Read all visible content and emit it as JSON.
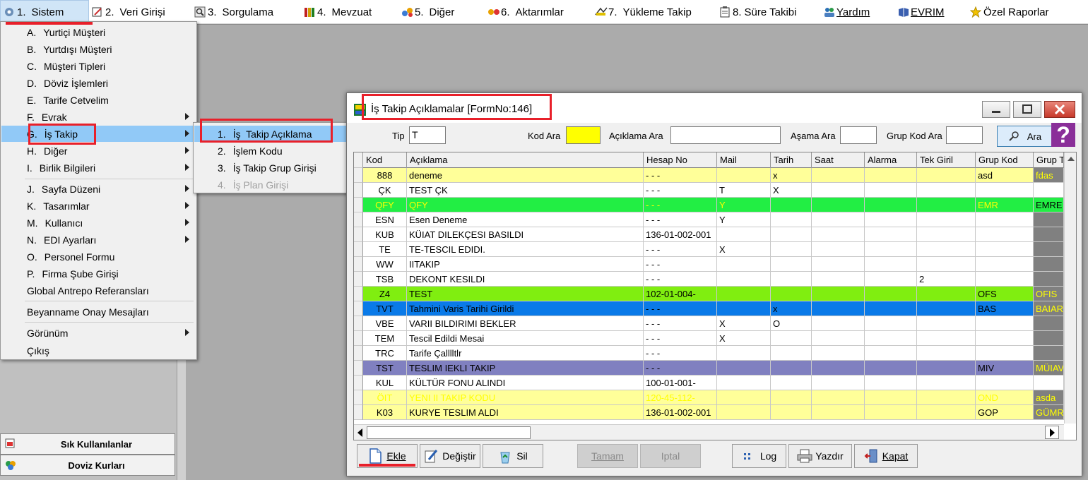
{
  "menubar": {
    "items": [
      {
        "num": "1.",
        "label": "Sistem"
      },
      {
        "num": "2.",
        "label": "Veri Girişi"
      },
      {
        "num": "3.",
        "label": "Sorgulama"
      },
      {
        "num": "4.",
        "label": "Mevzuat"
      },
      {
        "num": "5.",
        "label": "Diğer"
      },
      {
        "num": "6.",
        "label": "Aktarımlar"
      },
      {
        "num": "7.",
        "label": "Yükleme Takip"
      },
      {
        "num": "8.",
        "label": "Süre Takibi"
      },
      {
        "num": "",
        "label": "Yardım"
      },
      {
        "num": "",
        "label": "EVRIM"
      },
      {
        "num": "",
        "label": "Özel Raporlar"
      }
    ]
  },
  "sistem_menu": {
    "items": [
      {
        "key": "A.",
        "label": "Yurtiçi Müşteri"
      },
      {
        "key": "B.",
        "label": "Yurtdışı Müşteri"
      },
      {
        "key": "C.",
        "label": "Müşteri Tipleri"
      },
      {
        "key": "D.",
        "label": "Döviz İşlemleri"
      },
      {
        "key": "E.",
        "label": "Tarife Cetvelim"
      },
      {
        "key": "F.",
        "label": "Evrak"
      },
      {
        "key": "G.",
        "label": "İş Takip"
      },
      {
        "key": "H.",
        "label": "Diğer"
      },
      {
        "key": "I.",
        "label": "Birlik Bilgileri"
      },
      {
        "key": "J.",
        "label": "Sayfa Düzeni"
      },
      {
        "key": "K.",
        "label": "Tasarımlar"
      },
      {
        "key": "M.",
        "label": "Kullanıcı"
      },
      {
        "key": "N.",
        "label": "EDI Ayarları"
      },
      {
        "key": "O.",
        "label": "Personel Formu"
      },
      {
        "key": "P.",
        "label": "Firma Şube Girişi"
      },
      {
        "key": "",
        "label": "Global Antrepo Referansları"
      },
      {
        "key": "",
        "label": "Beyanname Onay Mesajları"
      },
      {
        "key": "",
        "label": "Görünüm"
      },
      {
        "key": "",
        "label": "Çıkış"
      }
    ]
  },
  "is_takip_submenu": {
    "items": [
      {
        "key": "1.",
        "label": "İş  Takip Açıklama"
      },
      {
        "key": "2.",
        "label": "İşlem Kodu"
      },
      {
        "key": "3.",
        "label": "İş Takip Grup Girişi"
      },
      {
        "key": "4.",
        "label": "İş Plan Girişi"
      }
    ]
  },
  "left_panel": {
    "btn1": "Sık Kullanılanlar",
    "btn2": "Doviz Kurları"
  },
  "window": {
    "title": "İş Takip Açıklamalar [FormNo:146]",
    "search": {
      "tip_label": "Tip",
      "tip_value": "T",
      "kod_label": "Kod Ara",
      "kod_value": "",
      "aciklama_label": "Açıklama Ara",
      "asama_label": "Aşama Ara",
      "grupkod_label": "Grup Kod Ara",
      "ara_button": "Ara",
      "help": "?"
    },
    "grid": {
      "columns": [
        "Kod",
        "Açıklama",
        "Hesap No",
        "Mail",
        "Tarih",
        "Saat",
        "Alarma",
        "Tek Giril",
        "Grup Kod",
        "Grup T"
      ],
      "rows": [
        {
          "cells": [
            "888",
            "deneme",
            "- - -",
            "",
            "x",
            "",
            "",
            "",
            "asd",
            "fdas"
          ],
          "bg": "#ffff99",
          "fg": "#000000",
          "last_bg": "#808080",
          "last_fg": "#ffff00"
        },
        {
          "cells": [
            "ÇK",
            "TEST ÇK",
            "- - -",
            "T",
            "X",
            "",
            "",
            "",
            "",
            ""
          ],
          "bg": "#ffffff",
          "fg": "#000000",
          "last_bg": "#ffffff",
          "last_fg": "#000000"
        },
        {
          "cells": [
            "QFY",
            "QFY",
            "- - -",
            "Y",
            "",
            "",
            "",
            "",
            "EMR",
            "EMRE"
          ],
          "bg": "#22ee44",
          "fg": "#ffff00",
          "last_bg": "#22ee44",
          "last_fg": "#000000"
        },
        {
          "cells": [
            "ESN",
            "Esen Deneme",
            "- - -",
            "Y",
            "",
            "",
            "",
            "",
            "",
            ""
          ],
          "bg": "#ffffff",
          "fg": "#000000",
          "last_bg": "#808080",
          "last_fg": "#000000"
        },
        {
          "cells": [
            "KUB",
            "KÜIAT DILEKÇESI BASILDI",
            "136-01-002-001",
            "",
            "",
            "",
            "",
            "",
            "",
            ""
          ],
          "bg": "#ffffff",
          "fg": "#000000",
          "last_bg": "#808080",
          "last_fg": "#000000"
        },
        {
          "cells": [
            "TE",
            "TE-TESCIL EDIDI.",
            "- - -",
            "X",
            "",
            "",
            "",
            "",
            "",
            ""
          ],
          "bg": "#ffffff",
          "fg": "#000000",
          "last_bg": "#808080",
          "last_fg": "#000000"
        },
        {
          "cells": [
            "WW",
            "IITAKIP",
            "- - -",
            "",
            "",
            "",
            "",
            "",
            "",
            ""
          ],
          "bg": "#ffffff",
          "fg": "#000000",
          "last_bg": "#808080",
          "last_fg": "#000000"
        },
        {
          "cells": [
            "TSB",
            "DEKONT KESILDI",
            "- - -",
            "",
            "",
            "",
            "",
            "2",
            "",
            ""
          ],
          "bg": "#ffffff",
          "fg": "#000000",
          "last_bg": "#808080",
          "last_fg": "#000000"
        },
        {
          "cells": [
            "Z4",
            "TEST",
            "102-01-004-",
            "",
            "",
            "",
            "",
            "",
            "OFS",
            "OFIS"
          ],
          "bg": "#80ee10",
          "fg": "#000000",
          "last_bg": "#808080",
          "last_fg": "#ffff00"
        },
        {
          "cells": [
            "TVT",
            "Tahmini Varis Tarihi Girildi",
            "- - -",
            "",
            "x",
            "",
            "",
            "",
            "BAS",
            "BAIAR"
          ],
          "bg": "#0a7ae8",
          "fg": "#000000",
          "last_bg": "#808080",
          "last_fg": "#ffff00"
        },
        {
          "cells": [
            "VBE",
            "VARII BILDIRIMI BEKLER",
            "- - -",
            "X",
            "O",
            "",
            "",
            "",
            "",
            ""
          ],
          "bg": "#ffffff",
          "fg": "#000000",
          "last_bg": "#808080",
          "last_fg": "#000000"
        },
        {
          "cells": [
            "TEM",
            "Tescil Edildi Mesai",
            "- - -",
            "X",
            "",
            "",
            "",
            "",
            "",
            ""
          ],
          "bg": "#ffffff",
          "fg": "#000000",
          "last_bg": "#808080",
          "last_fg": "#000000"
        },
        {
          "cells": [
            "TRC",
            "Tarife Çalllltlr",
            "- - -",
            "",
            "",
            "",
            "",
            "",
            "",
            ""
          ],
          "bg": "#ffffff",
          "fg": "#000000",
          "last_bg": "#808080",
          "last_fg": "#000000"
        },
        {
          "cells": [
            "TST",
            "TESLIM IEKLI TAKIP",
            "- - -",
            "",
            "",
            "",
            "",
            "",
            "MIV",
            "MÜIAV"
          ],
          "bg": "#8080c0",
          "fg": "#000000",
          "last_bg": "#808080",
          "last_fg": "#ffff00"
        },
        {
          "cells": [
            "KUL",
            "KÜLTÜR FONU ALINDI",
            "100-01-001-",
            "",
            "",
            "",
            "",
            "",
            "",
            ""
          ],
          "bg": "#ffffff",
          "fg": "#000000",
          "last_bg": "#ffffff",
          "last_fg": "#000000"
        },
        {
          "cells": [
            "ÖIT",
            "YENI II TAKIP KODU",
            "120-45-112-",
            "",
            "",
            "",
            "",
            "",
            "OND",
            "asda"
          ],
          "bg": "#ffff99",
          "fg": "#ffff00",
          "last_bg": "#808080",
          "last_fg": "#ffff00"
        },
        {
          "cells": [
            "K03",
            "KURYE TESLIM ALDI",
            "136-01-002-001",
            "",
            "",
            "",
            "",
            "",
            "GOP",
            "GÜMR"
          ],
          "bg": "#ffff99",
          "fg": "#000000",
          "last_bg": "#808080",
          "last_fg": "#ffff00"
        }
      ]
    },
    "buttons": {
      "ekle": "Ekle",
      "degistir": "Değiştir",
      "sil": "Sil",
      "tamam": "Tamam",
      "iptal": "Iptal",
      "log": "Log",
      "yazdir": "Yazdır",
      "kapat": "Kapat"
    }
  },
  "colors": {
    "highlight": "#e8202a",
    "menu_selected": "#91c9f7"
  }
}
